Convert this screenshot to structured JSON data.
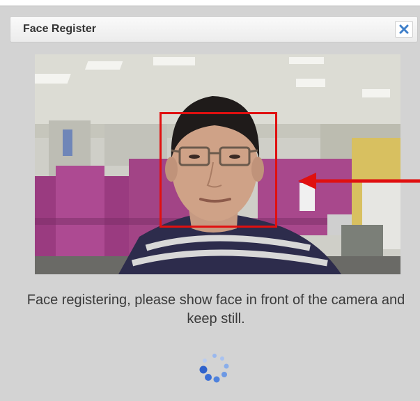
{
  "dialog": {
    "title": "Face Register",
    "close_icon": "close-x-icon",
    "status_message": "Face registering, please show face in front of the camera and keep still.",
    "spinner_icon": "loading-spinner-icon"
  },
  "colors": {
    "face_box": "#e01010",
    "accent_close": "#3d7ec9",
    "spinner": "#3b6fd6"
  }
}
